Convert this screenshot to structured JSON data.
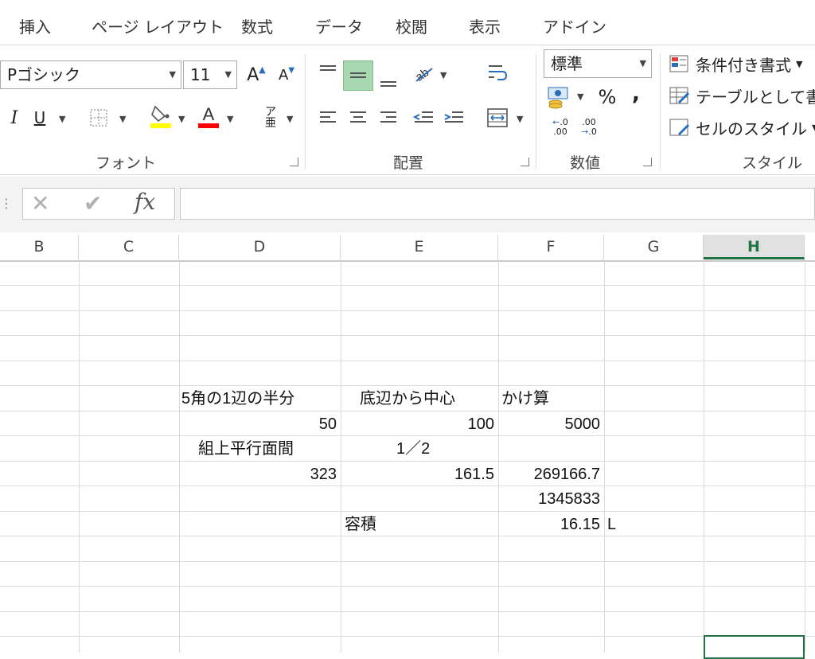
{
  "menu": {
    "tabs": [
      "挿入",
      "ページ レイアウト",
      "数式",
      "データ",
      "校閲",
      "表示",
      "アドイン"
    ]
  },
  "ribbon": {
    "font": {
      "name": "Pゴシック",
      "size": "11",
      "group_label": "フォント"
    },
    "alignment": {
      "group_label": "配置"
    },
    "number": {
      "format": "標準",
      "group_label": "数値"
    },
    "styles": {
      "conditional_formatting": "条件付き書式",
      "format_as_table": "テーブルとして書式",
      "cell_styles": "セルのスタイル",
      "group_label": "スタイル"
    },
    "colors": {
      "highlight": "#ffff00",
      "font": "#ff0000",
      "active_align": "#a8d8b0"
    }
  },
  "formula_bar": {
    "fx": "fx",
    "value": ""
  },
  "sheet": {
    "columns": [
      "B",
      "C",
      "D",
      "E",
      "F",
      "G",
      "H"
    ],
    "selected_column": "H",
    "accent": "#217346",
    "cells": {
      "d6": "5角の1辺の半分",
      "e6": "底辺から中心",
      "f6": "かけ算",
      "d7": "50",
      "e7": "100",
      "f7": "5000",
      "d8": "組上平行面間",
      "e8": "1／2",
      "d9": "323",
      "e9": "161.5",
      "f9": "269166.7",
      "f10": "1345833",
      "e11": "容積",
      "f11": "16.15",
      "g11": "L"
    }
  }
}
